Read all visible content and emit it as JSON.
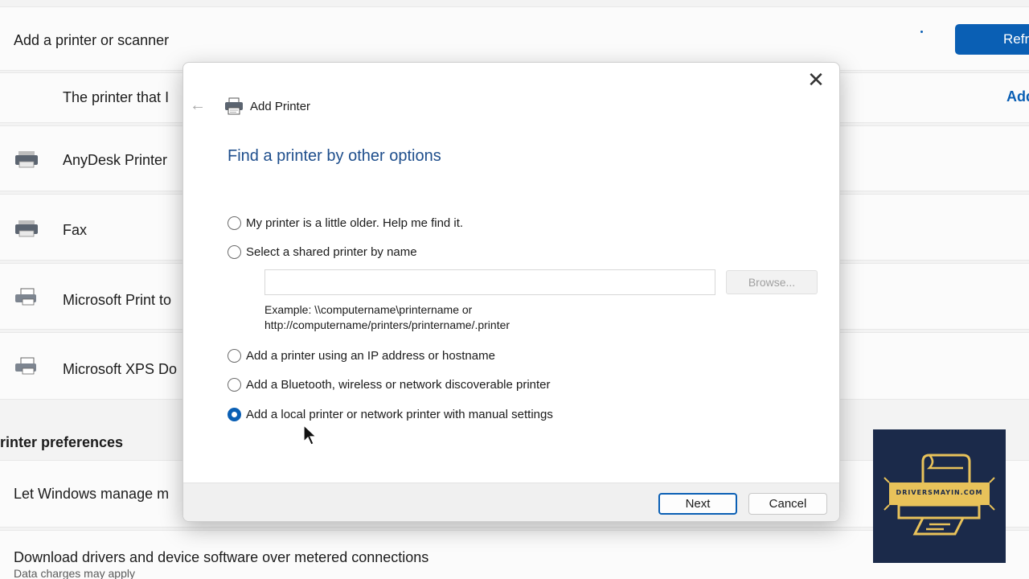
{
  "background": {
    "add_row_title": "Add a printer or scanner",
    "refresh_button": "Refr",
    "not_listed_text": "The printer that I",
    "add_manually_link": "Add",
    "devices": [
      {
        "name": "AnyDesk Printer",
        "icon": "printer-icon"
      },
      {
        "name": "Fax",
        "icon": "fax-icon"
      },
      {
        "name": "Microsoft Print to",
        "icon": "pdf-printer-icon"
      },
      {
        "name": "Microsoft XPS Do",
        "icon": "xps-printer-icon"
      }
    ],
    "preferences_title": "rinter preferences",
    "let_windows_manage": "Let Windows manage m",
    "download_drivers_title": "Download drivers and device software over metered connections",
    "download_drivers_sub": "Data charges may apply"
  },
  "dialog": {
    "title": "Add Printer",
    "heading": "Find a printer by other options",
    "options": [
      {
        "label": "My printer is a little older. Help me find it.",
        "checked": false
      },
      {
        "label": "Select a shared printer by name",
        "checked": false
      },
      {
        "label": "Add a printer using an IP address or hostname",
        "checked": false
      },
      {
        "label": "Add a Bluetooth, wireless or network discoverable printer",
        "checked": false
      },
      {
        "label": "Add a local printer or network printer with manual settings",
        "checked": true
      }
    ],
    "shared_name_value": "",
    "browse_button": "Browse...",
    "example_line1": "Example: \\\\computername\\printername or",
    "example_line2": "http://computername/printers/printername/.printer",
    "next_button": "Next",
    "cancel_button": "Cancel",
    "close_symbol": "✕",
    "back_symbol": "←"
  },
  "watermark": {
    "text": "DRIVERSMAYIN.COM"
  },
  "colors": {
    "accent": "#0a5fb4",
    "heading": "#1e4e8c",
    "logo_bg": "#1b2a4a",
    "logo_gold": "#e8c25a"
  }
}
